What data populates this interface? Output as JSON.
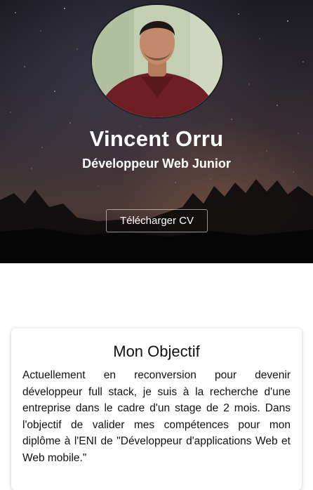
{
  "profile": {
    "name": "Vincent Orru",
    "role": "Développeur Web Junior",
    "cv_button": "Télécharger CV"
  },
  "objective": {
    "title": "Mon Objectif",
    "text": "Actuellement en reconversion pour devenir développeur full stack, je suis à la recherche d'une entreprise dans le cadre d'un stage de 2 mois. Dans l'objectif de valider mes compétences pour mon diplôme à l'ENI de \"Développeur d'applications Web et Web mobile.\""
  },
  "colors": {
    "hero_text": "#ffffff",
    "body_text": "#111111",
    "card_background": "#ffffff"
  },
  "icons": {
    "avatar": "profile-photo"
  }
}
